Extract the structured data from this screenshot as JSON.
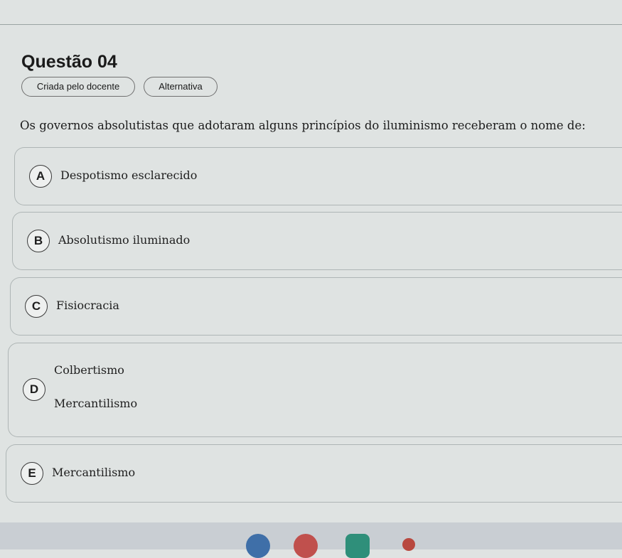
{
  "question": {
    "title": "Questão 04",
    "tags": [
      "Criada pelo docente",
      "Alternativa"
    ],
    "prompt": "Os governos absolutistas que adotaram alguns princípios do iluminismo receberam o nome de:"
  },
  "options": [
    {
      "letter": "A",
      "lines": [
        "Despotismo esclarecido"
      ]
    },
    {
      "letter": "B",
      "lines": [
        "Absolutismo iluminado"
      ]
    },
    {
      "letter": "C",
      "lines": [
        "Fisiocracia"
      ]
    },
    {
      "letter": "D",
      "lines": [
        "Colbertismo",
        "Mercantilismo"
      ]
    },
    {
      "letter": "E",
      "lines": [
        "Mercantilismo"
      ]
    }
  ],
  "shelf": {
    "icons": [
      "browser-icon",
      "app-icon",
      "classroom-icon",
      "notification-icon"
    ]
  }
}
